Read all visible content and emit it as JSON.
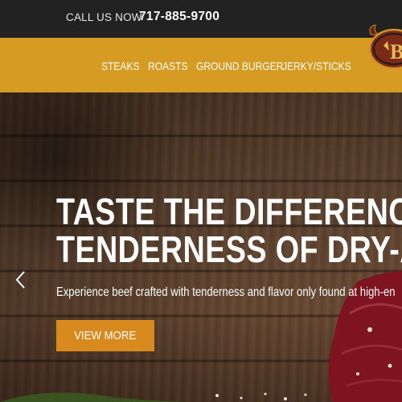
{
  "topbar": {
    "call_label": "CALL US NOW",
    "phone": "717-885-9700"
  },
  "nav": {
    "items": [
      {
        "label": "STEAKS"
      },
      {
        "label": "ROASTS"
      },
      {
        "label": "GROUND BURGER"
      },
      {
        "label": "JERKY/STICKS"
      }
    ],
    "logo_icon": "bull-head-logo"
  },
  "hero": {
    "headline_line1": "TASTE THE DIFFERENCE A",
    "headline_line2": "TENDERNESS OF DRY-AGI",
    "subtext": "Experience beef crafted with tenderness and flavor only found at high-en",
    "cta_label": "VIEW MORE",
    "prev_icon": "chevron-left-icon"
  },
  "colors": {
    "topbar_bg": "#222222",
    "nav_bg": "#d69b22",
    "cta_bg": "#d98a1f",
    "text": "#ffffff"
  }
}
